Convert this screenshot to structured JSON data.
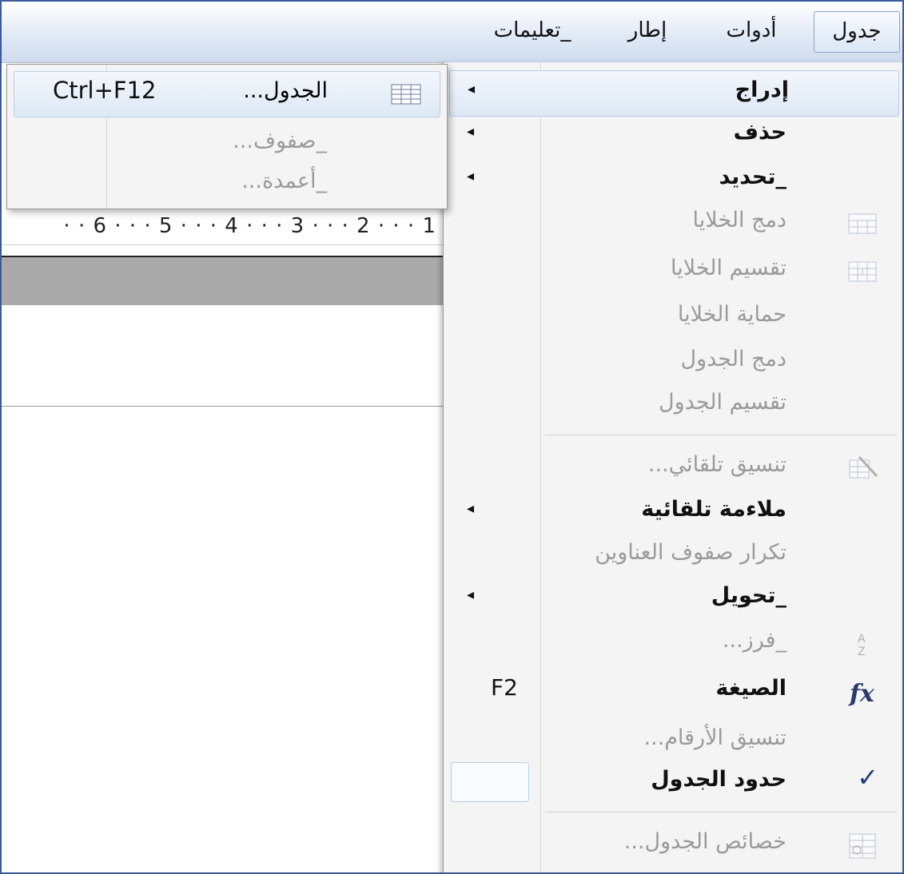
{
  "menubar": {
    "items": [
      {
        "label": "جدول",
        "active": true
      },
      {
        "label": "أدوات"
      },
      {
        "label": "إطار"
      },
      {
        "label": "_تعليمات"
      }
    ]
  },
  "ruler": {
    "text": "· · 6 · · · 5 · · · 4 · · · 3 · · · 2 · · · 1"
  },
  "submenu": {
    "items": [
      {
        "label": "الجدول...",
        "shortcut": "Ctrl+F12",
        "icon": "table-icon"
      },
      {
        "label": "_صفوف..."
      },
      {
        "label": "_أعمدة..."
      }
    ]
  },
  "dropdown": {
    "items": [
      {
        "label": "إدراج"
      },
      {
        "label": "حذف"
      },
      {
        "label": "_تحديد"
      },
      {
        "label": "دمج الخلايا",
        "icon": "merge-cells-icon"
      },
      {
        "label": "تقسيم الخلايا",
        "icon": "split-cells-icon"
      },
      {
        "label": "حماية الخلايا"
      },
      {
        "label": "دمج الجدول"
      },
      {
        "label": "تقسيم الجدول"
      },
      {
        "label": "تنسيق تلقائي...",
        "icon": "autoformat-icon"
      },
      {
        "label": "ملاءمة تلقائية"
      },
      {
        "label": "تكرار صفوف العناوين"
      },
      {
        "label": "_تحويل"
      },
      {
        "label": "_فرز...",
        "icon": "sort-icon"
      },
      {
        "label": "الصيغة",
        "shortcut": "F2",
        "icon": "formula-icon",
        "icon_text": "fx"
      },
      {
        "label": "تنسيق الأرقام..."
      },
      {
        "label": "حدود الجدول",
        "check": "✓"
      },
      {
        "label": "خصائص الجدول...",
        "icon": "table-properties-icon"
      }
    ]
  }
}
